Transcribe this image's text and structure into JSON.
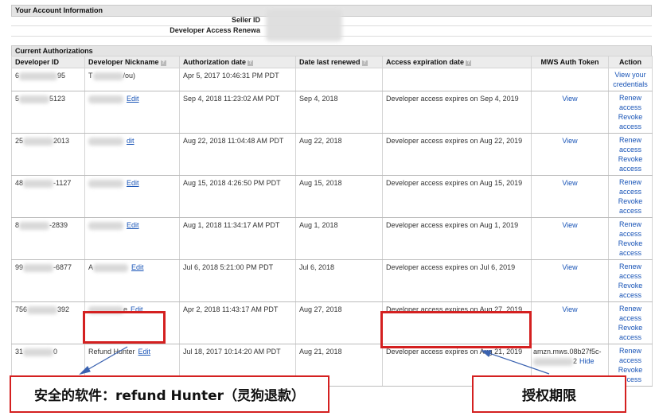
{
  "account": {
    "section_title": "Your Account Information",
    "seller_id_label": "Seller ID",
    "dev_access_label": "Developer Access Renewa"
  },
  "auth": {
    "section_title": "Current Authorizations",
    "columns": [
      {
        "label": "Developer ID",
        "help": false
      },
      {
        "label": "Developer Nickname",
        "help": true
      },
      {
        "label": "Authorization date",
        "help": true
      },
      {
        "label": "Date last renewed",
        "help": true
      },
      {
        "label": "Access expiration date",
        "help": true
      },
      {
        "label": "MWS Auth Token",
        "help": false
      },
      {
        "label": "Action",
        "help": false
      }
    ],
    "rows": [
      {
        "dev_id": "6",
        "dev_id_tail": "95",
        "nick": "T",
        "nick_tail": "/ou)",
        "edit": "",
        "auth_date": "Apr 5, 2017 10:46:31 PM PDT",
        "renewed": "",
        "exp_prefix": "",
        "exp_date": "",
        "token": "",
        "actions": [
          "View your credentials"
        ]
      },
      {
        "dev_id": "5",
        "dev_id_tail": "5123",
        "nick": "",
        "nick_tail": "",
        "edit": "Edit",
        "auth_date": "Sep 4, 2018 11:23:02 AM PDT",
        "renewed": "Sep 4, 2018",
        "exp_prefix": "Developer access expires on",
        "exp_date": "Sep 4, 2019",
        "token": "View",
        "actions": [
          "Renew access",
          "Revoke access"
        ]
      },
      {
        "dev_id": "25",
        "dev_id_tail": "2013",
        "nick": "",
        "nick_tail": "",
        "edit": "dit",
        "auth_date": "Aug 22, 2018 11:04:48 AM PDT",
        "renewed": "Aug 22, 2018",
        "exp_prefix": "Developer access expires on",
        "exp_date": "Aug 22, 2019",
        "token": "View",
        "actions": [
          "Renew access",
          "Revoke access"
        ]
      },
      {
        "dev_id": "48",
        "dev_id_tail": "-1127",
        "nick": "",
        "nick_tail": "",
        "edit": "Edit",
        "auth_date": "Aug 15, 2018 4:26:50 PM PDT",
        "renewed": "Aug 15, 2018",
        "exp_prefix": "Developer access expires on",
        "exp_date": "Aug 15, 2019",
        "token": "View",
        "actions": [
          "Renew access",
          "Revoke access"
        ]
      },
      {
        "dev_id": "8",
        "dev_id_tail": "-2839",
        "nick": "",
        "nick_tail": "",
        "edit": "Edit",
        "auth_date": "Aug 1, 2018 11:34:17 AM PDT",
        "renewed": "Aug 1, 2018",
        "exp_prefix": "Developer access expires on",
        "exp_date": "Aug 1, 2019",
        "token": "View",
        "actions": [
          "Renew access",
          "Revoke access"
        ]
      },
      {
        "dev_id": "99",
        "dev_id_tail": "-6877",
        "nick": "A",
        "nick_tail": "",
        "edit": "Edit",
        "auth_date": "Jul 6, 2018 5:21:00 PM PDT",
        "renewed": "Jul 6, 2018",
        "exp_prefix": "Developer access expires on",
        "exp_date": "Jul 6, 2019",
        "token": "View",
        "actions": [
          "Renew access",
          "Revoke access"
        ]
      },
      {
        "dev_id": "756",
        "dev_id_tail": "392",
        "nick": "",
        "nick_tail": "e",
        "edit": "Edit",
        "auth_date": "Apr 2, 2018 11:43:17 AM PDT",
        "renewed": "Aug 27, 2018",
        "exp_prefix": "Developer access expires on",
        "exp_date": "Aug 27, 2019",
        "token": "View",
        "actions": [
          "Renew access",
          "Revoke access"
        ]
      },
      {
        "dev_id": "31",
        "dev_id_tail": "0",
        "nick": "Refund Hunter",
        "nick_tail": "",
        "edit": "Edit",
        "auth_date": "Jul 18, 2017 10:14:20 AM PDT",
        "renewed": "Aug 21, 2018",
        "exp_prefix": "Developer access expires on",
        "exp_date": "Aug 21, 2019",
        "token": "amzn.mws.08b27f5c-",
        "token_tail": "2",
        "token_hide": "Hide",
        "actions": [
          "Renew access",
          "Revoke access"
        ]
      }
    ]
  },
  "annotations": {
    "left_callout": "安全的软件：refund Hunter（灵狗退款）",
    "right_callout": "授权期限",
    "accent": "#d42020"
  }
}
